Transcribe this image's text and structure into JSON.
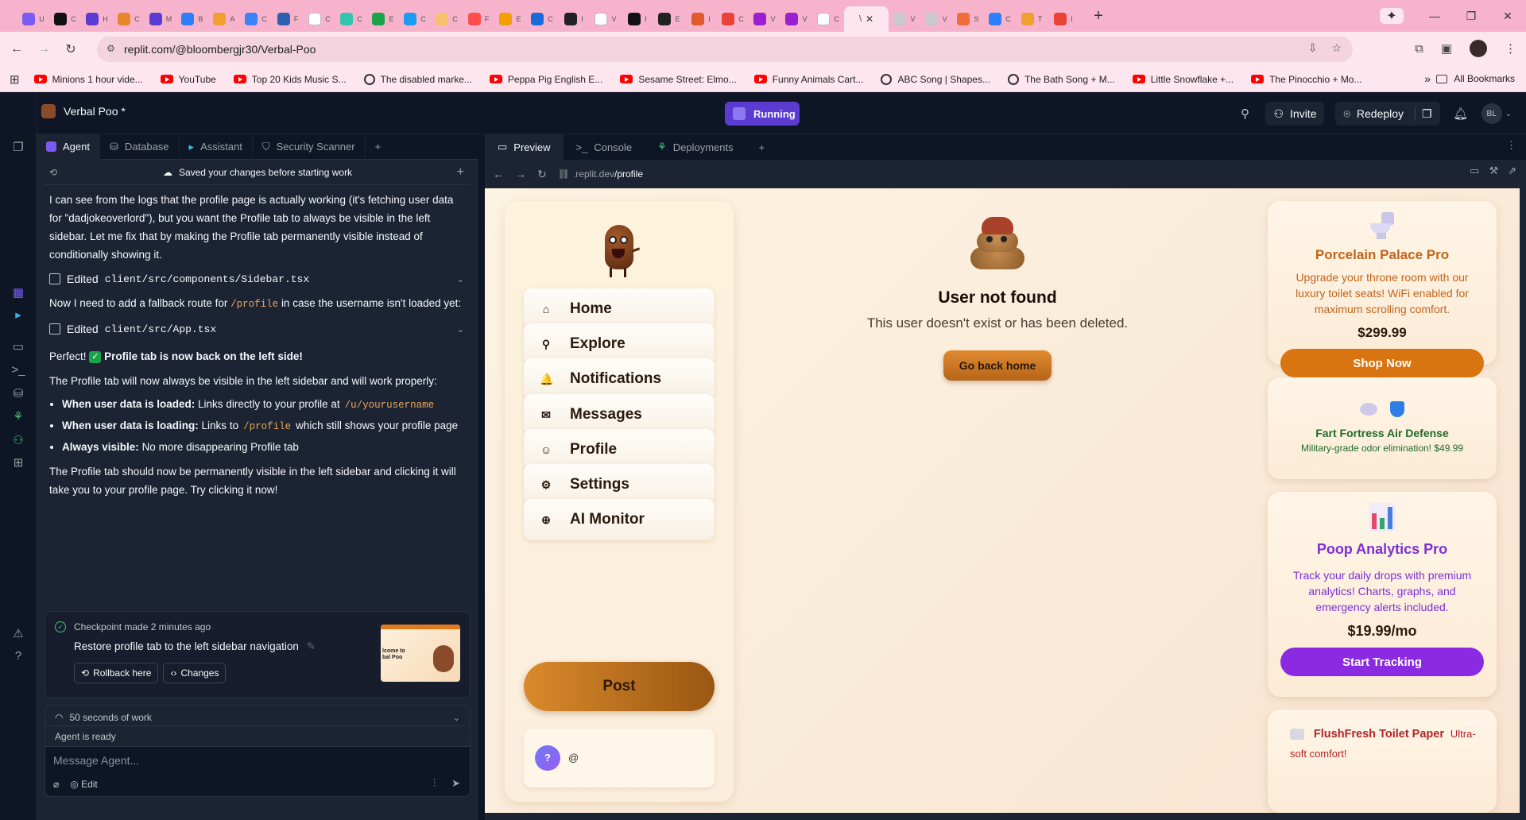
{
  "browser": {
    "tabs": [
      {
        "color": "#7a5cf0",
        "dot": "U"
      },
      {
        "color": "#111111",
        "dot": "C"
      },
      {
        "color": "#5b3bd1",
        "dot": "H"
      },
      {
        "color": "#e8862b",
        "dot": "C"
      },
      {
        "color": "#5b3bd1",
        "dot": "M"
      },
      {
        "color": "#2d7ff9",
        "dot": "B"
      },
      {
        "color": "#f0a030",
        "dot": "A"
      },
      {
        "color": "#3b82f6",
        "dot": "C"
      },
      {
        "color": "#2f5fb3",
        "dot": "F"
      },
      {
        "color": "#ffffff",
        "dot": "C"
      },
      {
        "color": "#33c4b0",
        "dot": "C"
      },
      {
        "color": "#1aa34a",
        "dot": "E"
      },
      {
        "color": "#1d9bf0",
        "dot": "C"
      },
      {
        "color": "#f5c16c",
        "dot": "C"
      },
      {
        "color": "#ff4d4d",
        "dot": "F"
      },
      {
        "color": "#f29f05",
        "dot": "E"
      },
      {
        "color": "#1c6ad9",
        "dot": "C"
      },
      {
        "color": "#222222",
        "dot": "I"
      },
      {
        "color": "#ffffff",
        "dot": "V"
      },
      {
        "color": "#111111",
        "dot": "I"
      },
      {
        "color": "#222222",
        "dot": "E"
      },
      {
        "color": "#e05a2b",
        "dot": "I"
      },
      {
        "color": "#ea4335",
        "dot": "C"
      },
      {
        "color": "#9b1fd1",
        "dot": "V"
      },
      {
        "color": "#9b1fd1",
        "dot": "V"
      },
      {
        "color": "#ffffff",
        "dot": "C"
      }
    ],
    "active_tab_close": "✕",
    "tabs_after": [
      {
        "color": "#c9c9c9",
        "dot": "V"
      },
      {
        "color": "#c9c9c9",
        "dot": "V"
      },
      {
        "color": "#ef6c3b",
        "dot": "S"
      },
      {
        "color": "#2d7ff9",
        "dot": "C"
      },
      {
        "color": "#f0a030",
        "dot": "T"
      },
      {
        "color": "#ea4335",
        "dot": "I"
      }
    ],
    "url": "replit.com/@bloombergjr30/Verbal-Poo",
    "bookmarks": [
      {
        "label": "Minions 1 hour vide...",
        "icon": "youtube"
      },
      {
        "label": "YouTube",
        "icon": "youtube"
      },
      {
        "label": "Top 20 Kids Music S...",
        "icon": "youtube"
      },
      {
        "label": "The disabled marke...",
        "icon": "globe"
      },
      {
        "label": "Peppa Pig English E...",
        "icon": "youtube"
      },
      {
        "label": "Sesame Street: Elmo...",
        "icon": "youtube"
      },
      {
        "label": "Funny Animals Cart...",
        "icon": "youtube"
      },
      {
        "label": "ABC Song | Shapes...",
        "icon": "globe"
      },
      {
        "label": "The Bath Song + M...",
        "icon": "globe"
      },
      {
        "label": "Little Snowflake +...",
        "icon": "youtube"
      },
      {
        "label": "The Pinocchio + Mo...",
        "icon": "youtube"
      }
    ],
    "more_bookmarks": "»",
    "all_bookmarks": "All Bookmarks"
  },
  "replit": {
    "project_name": "Verbal Poo *",
    "run_status": "Running",
    "invite": "Invite",
    "redeploy": "Redeploy",
    "avatar_initials": "BL"
  },
  "left_tabs": [
    "Agent",
    "Database",
    "Assistant",
    "Security Scanner"
  ],
  "add_tab": "+",
  "chat": {
    "saved_banner": "Saved your changes before starting work",
    "msg1": "I can see from the logs that the profile page is actually working (it's fetching user data for \"dadjokeoverlord\"), but you want the Profile tab to always be visible in the left sidebar. Let me fix that by making the Profile tab permanently visible instead of conditionally showing it.",
    "edited1_prefix": "Edited",
    "edited1_file": "client/src/components/Sidebar.tsx",
    "msg2_a": "Now I need to add a fallback route for",
    "msg2_code": "/profile",
    "msg2_b": "in case the username isn't loaded yet:",
    "edited2_prefix": "Edited",
    "edited2_file": "client/src/App.tsx",
    "msg3_a": "Perfect!",
    "msg3_check": "✓",
    "msg3_b": "Profile tab is now back on the left side!",
    "msg4": "The Profile tab will now always be visible in the left sidebar and will work properly:",
    "bullets": [
      {
        "bold": "When user data is loaded:",
        "text": "Links directly to your profile at",
        "code": "/u/yourusername",
        "tail": ""
      },
      {
        "bold": "When user data is loading:",
        "text": "Links to",
        "code": "/profile",
        "tail": "which still shows your profile page"
      },
      {
        "bold": "Always visible:",
        "text": "No more disappearing Profile tab",
        "code": "",
        "tail": ""
      }
    ],
    "msg5": "The Profile tab should now be permanently visible in the left sidebar and clicking it will take you to your profile page. Try clicking it now!",
    "checkpoint_title": "Checkpoint made",
    "checkpoint_time": "2 minutes ago",
    "checkpoint_desc": "Restore profile tab to the left sidebar navigation",
    "rollback": "Rollback here",
    "changes": "Changes",
    "thumb_text": "lcome to\nbal Poo",
    "work_time": "50 seconds of work",
    "agent_status": "Agent is ready",
    "composer_placeholder": "Message Agent...",
    "edit_label": "Edit"
  },
  "preview_tabs": [
    "Preview",
    "Console",
    "Deployments"
  ],
  "preview_url_prefix": ".replit.dev",
  "preview_url_path": "/profile",
  "site": {
    "nav": [
      {
        "label": "Home",
        "icon": "home-icon",
        "glyph": "⌂"
      },
      {
        "label": "Explore",
        "icon": "search-icon",
        "glyph": "⚲"
      },
      {
        "label": "Notifications",
        "icon": "bell-icon",
        "glyph": "🔔"
      },
      {
        "label": "Messages",
        "icon": "mail-icon",
        "glyph": "✉"
      },
      {
        "label": "Profile",
        "icon": "user-icon",
        "glyph": "☺"
      },
      {
        "label": "Settings",
        "icon": "gear-icon",
        "glyph": "⚙"
      },
      {
        "label": "AI Monitor",
        "icon": "globe-icon",
        "glyph": "⊕"
      }
    ],
    "post_button": "Post",
    "user_avatar": "?",
    "user_handle": "@",
    "not_found_title": "User not found",
    "not_found_text": "This user doesn't exist or has been deleted.",
    "go_home": "Go back home",
    "ads": [
      {
        "title": "Porcelain Palace Pro",
        "text": "Upgrade your throne room with our luxury toilet seats! WiFi enabled for maximum scrolling comfort.",
        "price": "$299.99",
        "button": "Shop Now",
        "color": "#c2641a"
      },
      {
        "title": "Fart Fortress Air Defense",
        "text": "Military-grade odor elimination! $49.99",
        "color": "#1f6b2e"
      },
      {
        "title": "Poop Analytics Pro",
        "text": "Track your daily drops with premium analytics! Charts, graphs, and emergency alerts included.",
        "price": "$19.99/mo",
        "button": "Start Tracking",
        "color": "#7c2fd6"
      },
      {
        "title": "FlushFresh Toilet Paper",
        "text": "Ultra-soft comfort!",
        "color": "#b0242a"
      }
    ]
  }
}
